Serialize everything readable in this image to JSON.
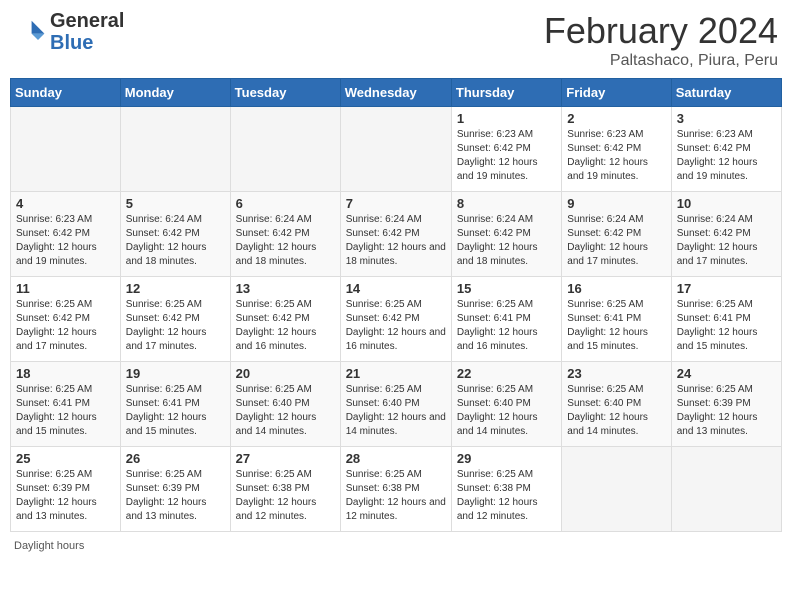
{
  "header": {
    "logo_general": "General",
    "logo_blue": "Blue",
    "month_title": "February 2024",
    "location": "Paltashaco, Piura, Peru"
  },
  "days_of_week": [
    "Sunday",
    "Monday",
    "Tuesday",
    "Wednesday",
    "Thursday",
    "Friday",
    "Saturday"
  ],
  "weeks": [
    [
      {
        "day": "",
        "info": ""
      },
      {
        "day": "",
        "info": ""
      },
      {
        "day": "",
        "info": ""
      },
      {
        "day": "",
        "info": ""
      },
      {
        "day": "1",
        "info": "Sunrise: 6:23 AM\nSunset: 6:42 PM\nDaylight: 12 hours and 19 minutes."
      },
      {
        "day": "2",
        "info": "Sunrise: 6:23 AM\nSunset: 6:42 PM\nDaylight: 12 hours and 19 minutes."
      },
      {
        "day": "3",
        "info": "Sunrise: 6:23 AM\nSunset: 6:42 PM\nDaylight: 12 hours and 19 minutes."
      }
    ],
    [
      {
        "day": "4",
        "info": "Sunrise: 6:23 AM\nSunset: 6:42 PM\nDaylight: 12 hours and 19 minutes."
      },
      {
        "day": "5",
        "info": "Sunrise: 6:24 AM\nSunset: 6:42 PM\nDaylight: 12 hours and 18 minutes."
      },
      {
        "day": "6",
        "info": "Sunrise: 6:24 AM\nSunset: 6:42 PM\nDaylight: 12 hours and 18 minutes."
      },
      {
        "day": "7",
        "info": "Sunrise: 6:24 AM\nSunset: 6:42 PM\nDaylight: 12 hours and 18 minutes."
      },
      {
        "day": "8",
        "info": "Sunrise: 6:24 AM\nSunset: 6:42 PM\nDaylight: 12 hours and 18 minutes."
      },
      {
        "day": "9",
        "info": "Sunrise: 6:24 AM\nSunset: 6:42 PM\nDaylight: 12 hours and 17 minutes."
      },
      {
        "day": "10",
        "info": "Sunrise: 6:24 AM\nSunset: 6:42 PM\nDaylight: 12 hours and 17 minutes."
      }
    ],
    [
      {
        "day": "11",
        "info": "Sunrise: 6:25 AM\nSunset: 6:42 PM\nDaylight: 12 hours and 17 minutes."
      },
      {
        "day": "12",
        "info": "Sunrise: 6:25 AM\nSunset: 6:42 PM\nDaylight: 12 hours and 17 minutes."
      },
      {
        "day": "13",
        "info": "Sunrise: 6:25 AM\nSunset: 6:42 PM\nDaylight: 12 hours and 16 minutes."
      },
      {
        "day": "14",
        "info": "Sunrise: 6:25 AM\nSunset: 6:42 PM\nDaylight: 12 hours and 16 minutes."
      },
      {
        "day": "15",
        "info": "Sunrise: 6:25 AM\nSunset: 6:41 PM\nDaylight: 12 hours and 16 minutes."
      },
      {
        "day": "16",
        "info": "Sunrise: 6:25 AM\nSunset: 6:41 PM\nDaylight: 12 hours and 15 minutes."
      },
      {
        "day": "17",
        "info": "Sunrise: 6:25 AM\nSunset: 6:41 PM\nDaylight: 12 hours and 15 minutes."
      }
    ],
    [
      {
        "day": "18",
        "info": "Sunrise: 6:25 AM\nSunset: 6:41 PM\nDaylight: 12 hours and 15 minutes."
      },
      {
        "day": "19",
        "info": "Sunrise: 6:25 AM\nSunset: 6:41 PM\nDaylight: 12 hours and 15 minutes."
      },
      {
        "day": "20",
        "info": "Sunrise: 6:25 AM\nSunset: 6:40 PM\nDaylight: 12 hours and 14 minutes."
      },
      {
        "day": "21",
        "info": "Sunrise: 6:25 AM\nSunset: 6:40 PM\nDaylight: 12 hours and 14 minutes."
      },
      {
        "day": "22",
        "info": "Sunrise: 6:25 AM\nSunset: 6:40 PM\nDaylight: 12 hours and 14 minutes."
      },
      {
        "day": "23",
        "info": "Sunrise: 6:25 AM\nSunset: 6:40 PM\nDaylight: 12 hours and 14 minutes."
      },
      {
        "day": "24",
        "info": "Sunrise: 6:25 AM\nSunset: 6:39 PM\nDaylight: 12 hours and 13 minutes."
      }
    ],
    [
      {
        "day": "25",
        "info": "Sunrise: 6:25 AM\nSunset: 6:39 PM\nDaylight: 12 hours and 13 minutes."
      },
      {
        "day": "26",
        "info": "Sunrise: 6:25 AM\nSunset: 6:39 PM\nDaylight: 12 hours and 13 minutes."
      },
      {
        "day": "27",
        "info": "Sunrise: 6:25 AM\nSunset: 6:38 PM\nDaylight: 12 hours and 12 minutes."
      },
      {
        "day": "28",
        "info": "Sunrise: 6:25 AM\nSunset: 6:38 PM\nDaylight: 12 hours and 12 minutes."
      },
      {
        "day": "29",
        "info": "Sunrise: 6:25 AM\nSunset: 6:38 PM\nDaylight: 12 hours and 12 minutes."
      },
      {
        "day": "",
        "info": ""
      },
      {
        "day": "",
        "info": ""
      }
    ]
  ],
  "footer": {
    "daylight_hours": "Daylight hours"
  }
}
